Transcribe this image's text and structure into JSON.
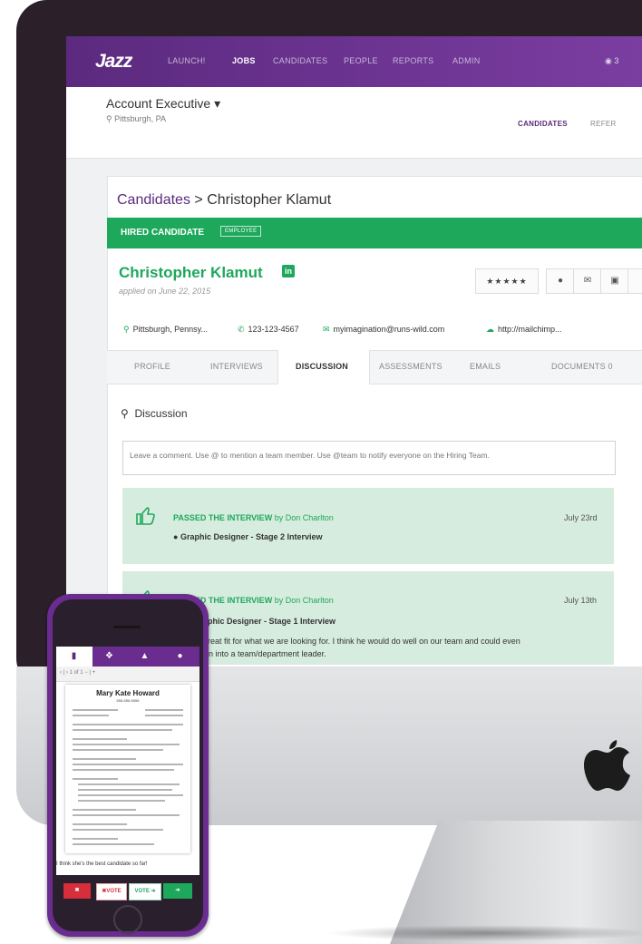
{
  "nav": {
    "logo": "Jazz",
    "items": [
      "LAUNCH!",
      "JOBS",
      "CANDIDATES",
      "PEOPLE",
      "REPORTS",
      "ADMIN"
    ],
    "active": "JOBS",
    "notifications": "◉ 3"
  },
  "job": {
    "title": "Account Executive",
    "location": "Pittsburgh, PA",
    "tabs": [
      "CANDIDATES",
      "REFER"
    ]
  },
  "breadcrumb": {
    "root": "Candidates",
    "separator": " > ",
    "current": "Christopher Klamut"
  },
  "status": {
    "label": "HIRED CANDIDATE",
    "badge": "EMPLOYEE"
  },
  "candidate": {
    "name": "Christopher Klamut",
    "applied": "applied on June 22, 2015",
    "rating": "★★★★★",
    "location": "Pittsburgh, Pennsy...",
    "phone": "123-123-4567",
    "email": "myimagination@runs-wild.com",
    "website": "http://mailchimp..."
  },
  "tabs": [
    "PROFILE",
    "INTERVIEWS",
    "DISCUSSION",
    "ASSESSMENTS",
    "EMAILS",
    "DOCUMENTS 0"
  ],
  "discussion": {
    "title": "Discussion",
    "placeholder": "Leave a comment. Use @ to mention a team member. Use @team to notify everyone on the Hiring Team."
  },
  "activities": [
    {
      "head": "PASSED THE INTERVIEW",
      "by": "by Don Charlton",
      "date": "July 23rd",
      "sub": "Graphic Designer - Stage 2 Interview"
    },
    {
      "head": "PASSED THE INTERVIEW",
      "by": "by Don Charlton",
      "date": "July 13th",
      "sub": "aphic Designer - Stage 1 Interview",
      "body_line1": "great fit for what we are looking for. I think he would do well on our team and could even",
      "body_line2": "n into a team/department leader."
    }
  ],
  "phone": {
    "resume_name": "Mary Kate Howard",
    "resume_sub": "555-555-5555",
    "toolbar": "‹ | ›  1  of 1   − | +",
    "caption": "I think she's the best candidate so far!",
    "btn_no": "✖",
    "btn_novote": "✖VOTE",
    "btn_vote": "VOTE ➔",
    "btn_yes": "➔"
  },
  "colors": {
    "brand_purple": "#5b2a7e",
    "success_green": "#1ea85c",
    "activity_bg": "#d6ecdf",
    "phone_shell": "#6a2c8f"
  }
}
